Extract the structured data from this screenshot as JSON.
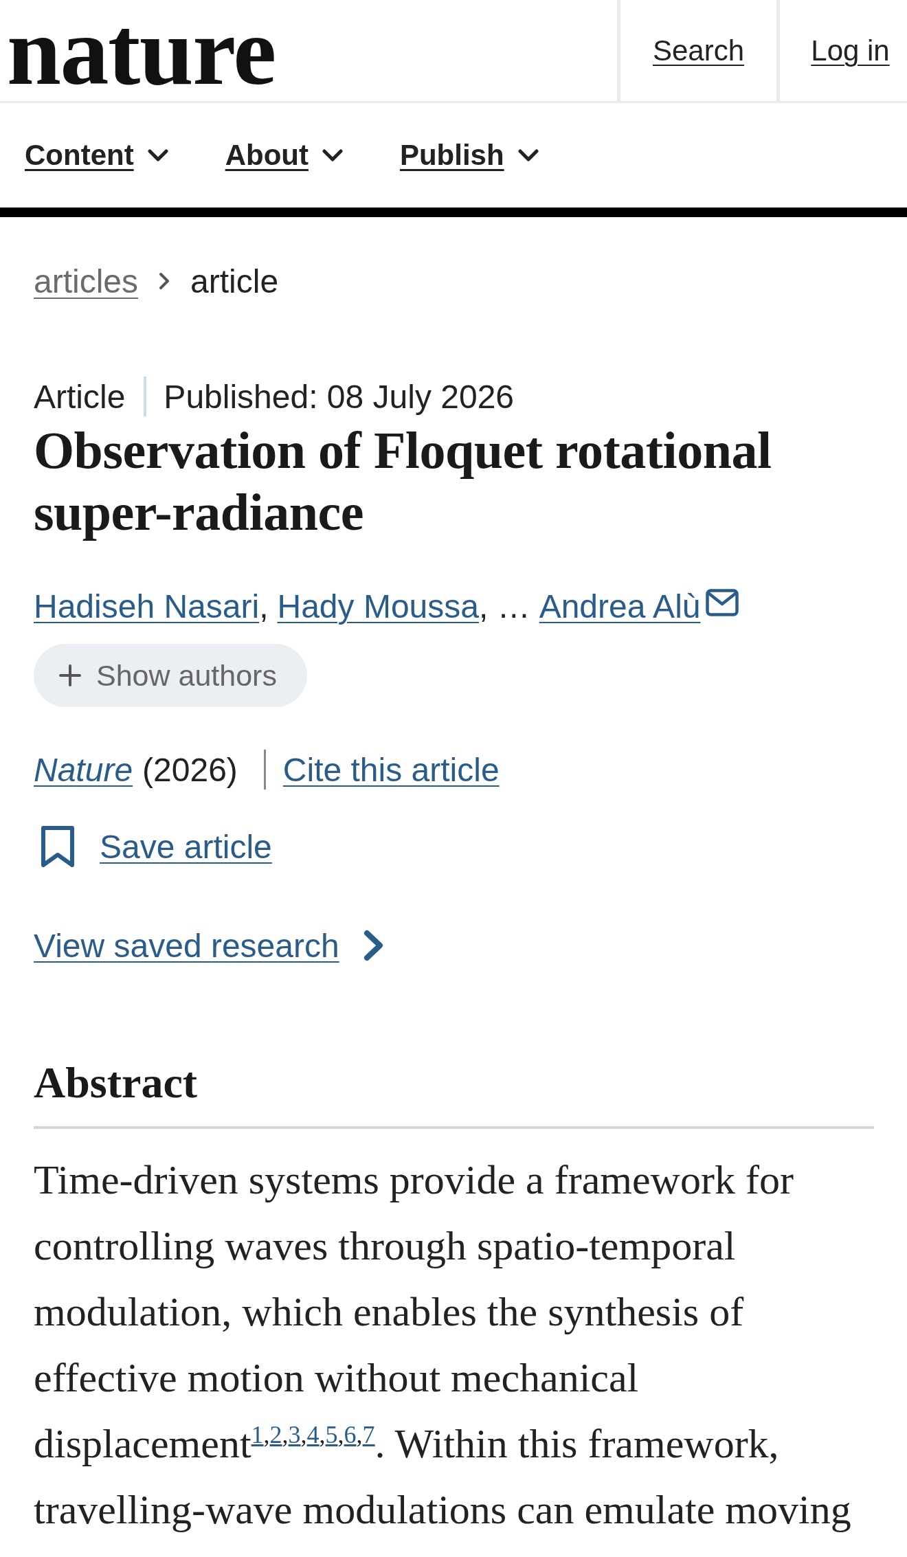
{
  "header": {
    "logo": "nature",
    "links": [
      {
        "label": "Search"
      },
      {
        "label": "Log in"
      }
    ]
  },
  "nav": {
    "items": [
      {
        "label": "Content"
      },
      {
        "label": "About"
      },
      {
        "label": "Publish"
      }
    ]
  },
  "breadcrumb": [
    {
      "kind": "link",
      "label": "articles"
    },
    {
      "kind": "current",
      "label": "article"
    }
  ],
  "article": {
    "type": "Article",
    "published": "Published: 08 July 2026",
    "title": "Observation of Floquet rotational super-radiance",
    "authors": [
      {
        "name": "Hadiseh Nasari",
        "email": false,
        "after": ","
      },
      {
        "name": "Hady Moussa",
        "email": false,
        "after": ", …"
      },
      {
        "name": "Andrea Alù",
        "email": true
      }
    ],
    "show_authors": "Show authors",
    "journal": "Nature",
    "year": "(2026)",
    "cite": "Cite this article",
    "save": "Save article",
    "view_saved": "View saved research"
  },
  "abstract": {
    "heading": "Abstract",
    "segments": [
      {
        "kind": "text",
        "text": "Time-driven systems provide a framework for controlling waves through spatio-temporal modulation, which enables the synthesis of effective motion without mechanical displacement"
      },
      {
        "kind": "ref",
        "text": "1"
      },
      {
        "kind": "sup",
        "text": ","
      },
      {
        "kind": "ref",
        "text": "2"
      },
      {
        "kind": "sup",
        "text": ","
      },
      {
        "kind": "ref",
        "text": "3"
      },
      {
        "kind": "sup",
        "text": ","
      },
      {
        "kind": "ref",
        "text": "4"
      },
      {
        "kind": "sup",
        "text": ","
      },
      {
        "kind": "ref",
        "text": "5"
      },
      {
        "kind": "sup",
        "text": ","
      },
      {
        "kind": "ref",
        "text": "6"
      },
      {
        "kind": "sup",
        "text": ","
      },
      {
        "kind": "ref",
        "text": "7"
      },
      {
        "kind": "text",
        "text": ". Within this framework, travelling-wave modulations can emulate moving"
      }
    ]
  }
}
